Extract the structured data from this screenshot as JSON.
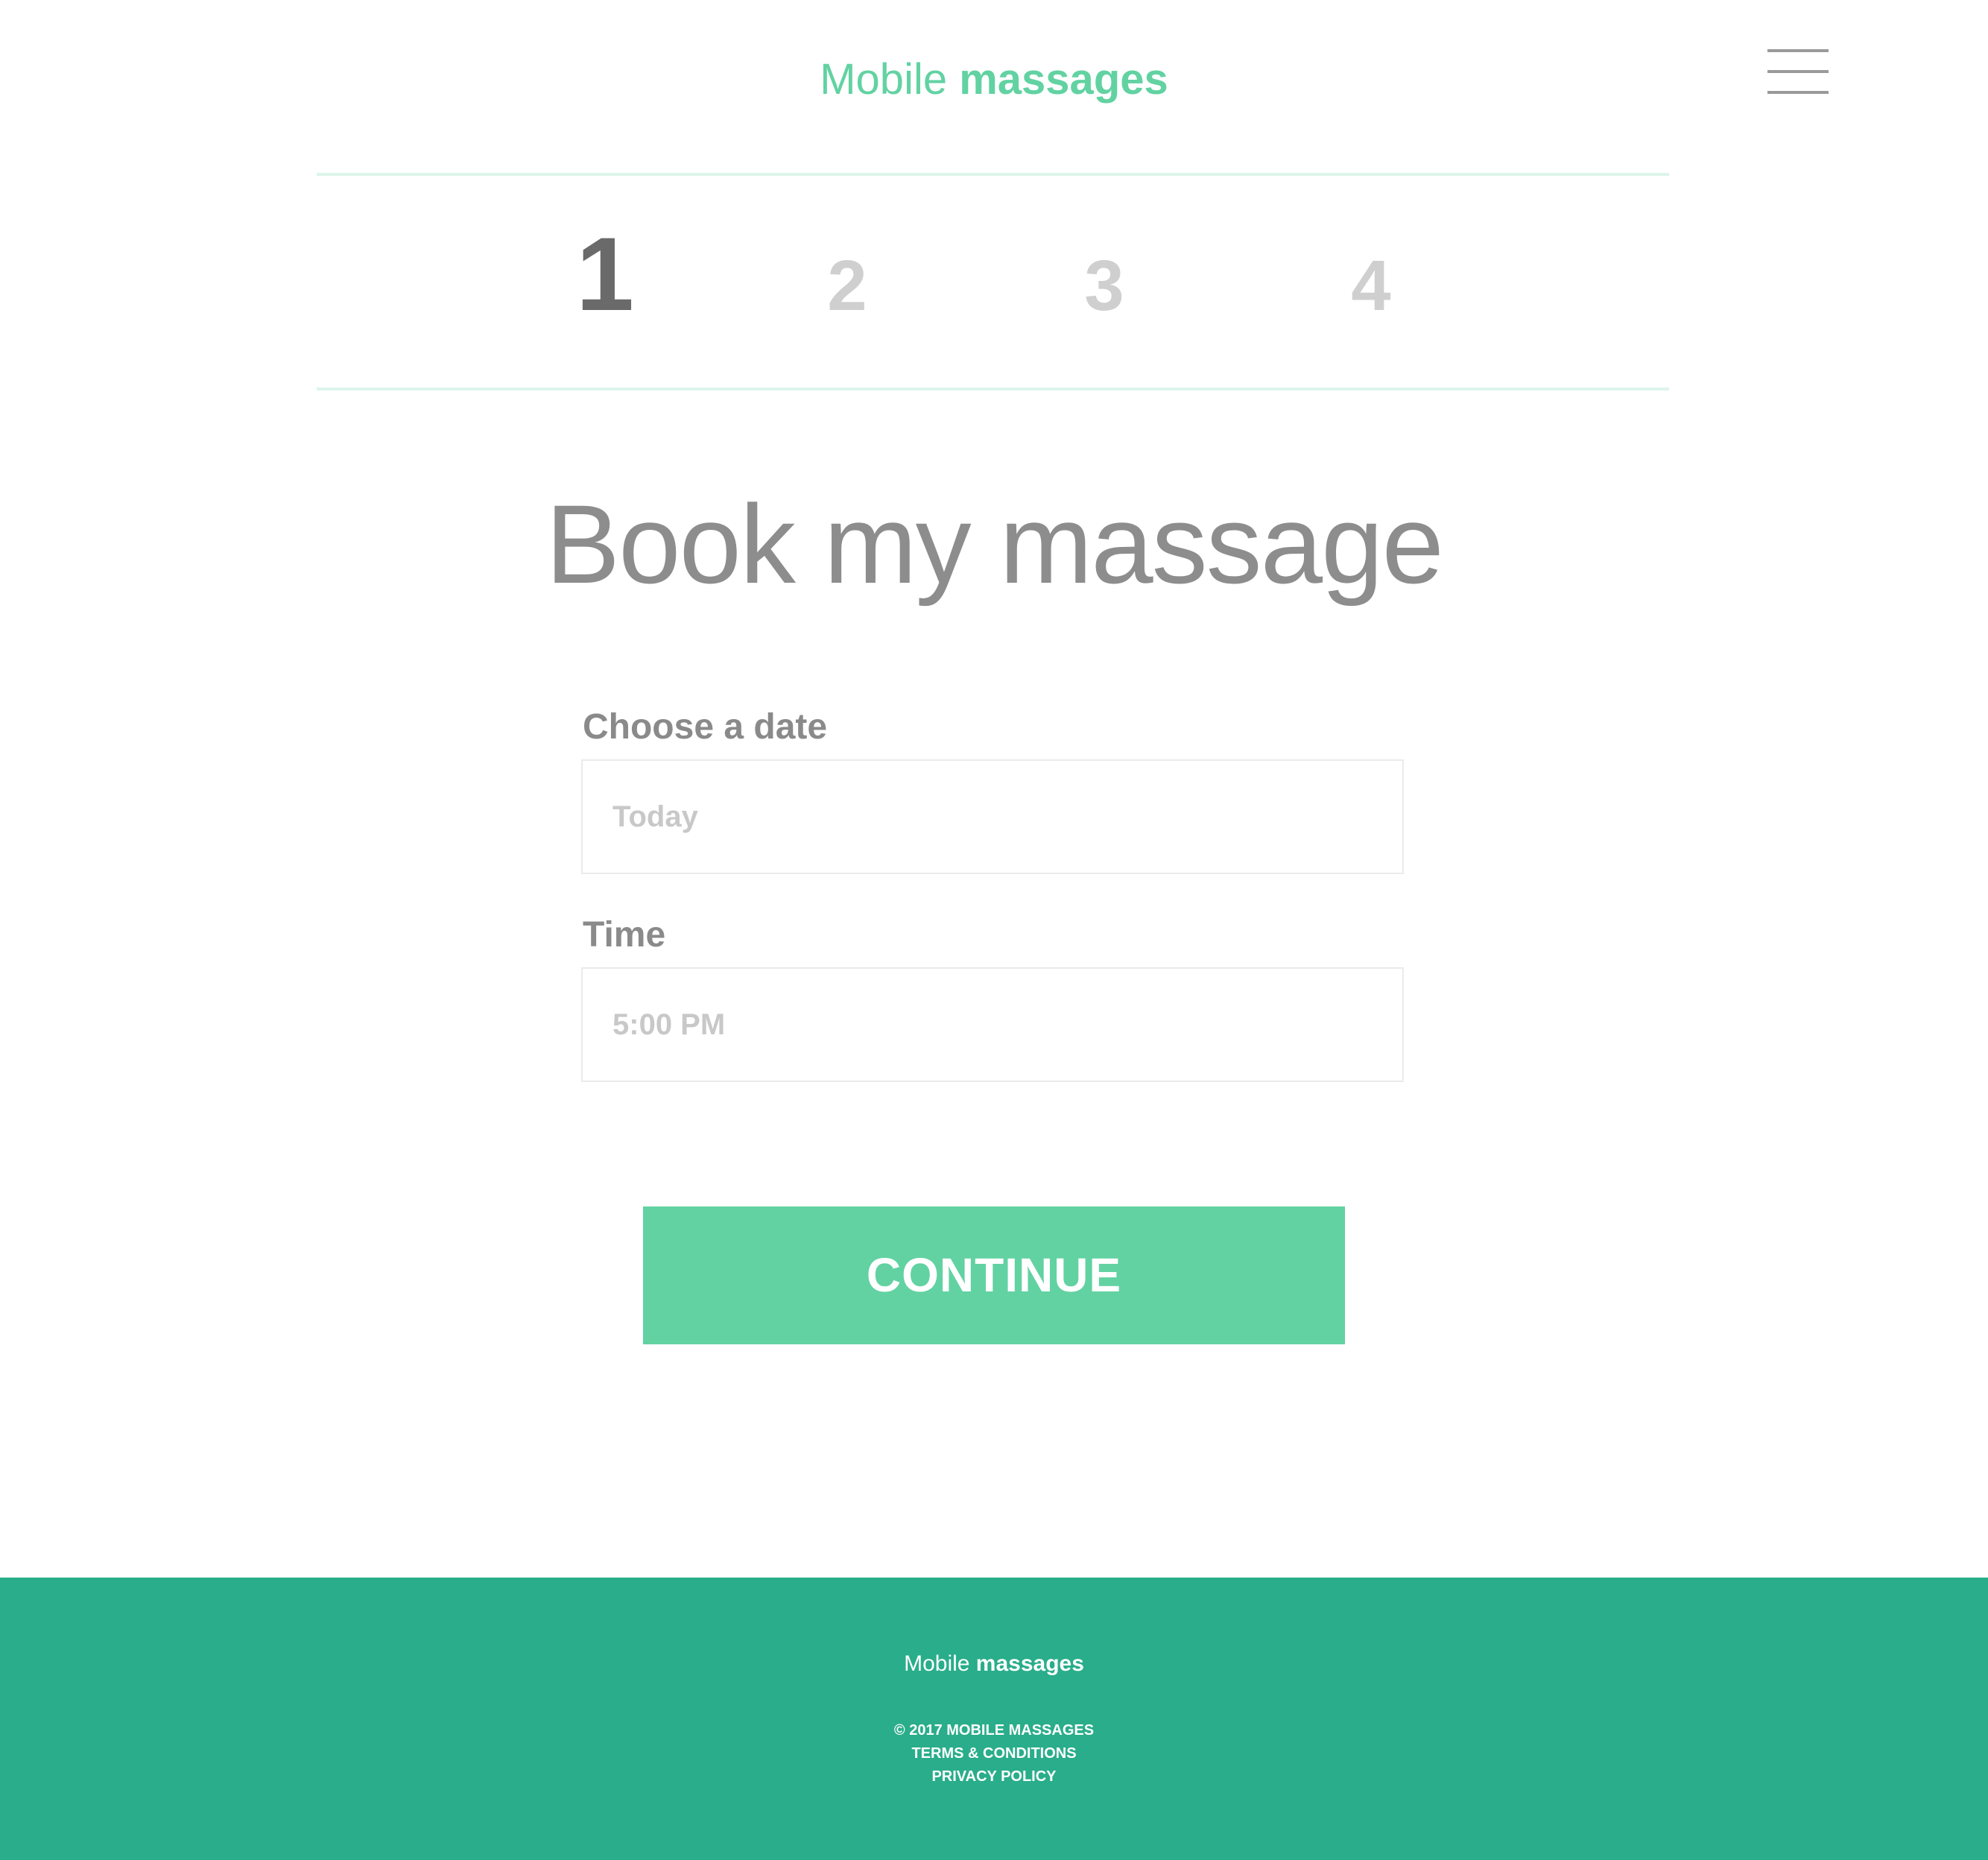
{
  "header": {
    "logo_light": "Mobile",
    "logo_bold": "massages",
    "menu_icon": "hamburger-menu-icon"
  },
  "steps": {
    "items": [
      "1",
      "2",
      "3",
      "4"
    ],
    "active_index": 0
  },
  "main": {
    "title": "Book my massage",
    "date_field": {
      "label": "Choose a date",
      "placeholder": "Today"
    },
    "time_field": {
      "label": "Time",
      "placeholder": "5:00 PM"
    },
    "continue_label": "CONTINUE"
  },
  "footer": {
    "logo_light": "Mobile",
    "logo_bold": "massages",
    "copyright": "© 2017 MOBILE MASSAGES",
    "terms": "TERMS & CONDITIONS",
    "privacy": "PRIVACY POLICY"
  },
  "colors": {
    "accent": "#62d2a2",
    "footer_bg": "#29ad8a",
    "divider": "#dcf5ea",
    "title_text": "#8d8d8d"
  }
}
